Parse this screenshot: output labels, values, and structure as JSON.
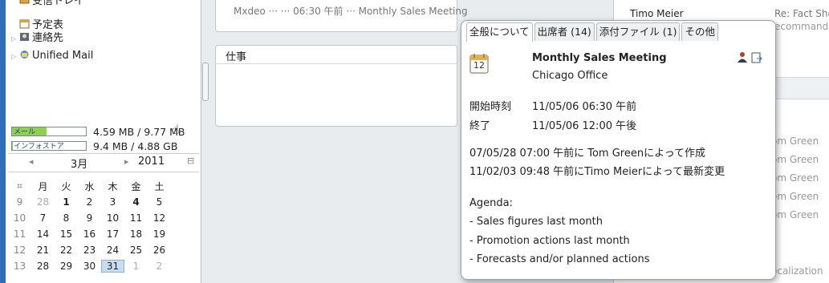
{
  "sidebar": {
    "top_item": "受信トレイ",
    "items": [
      {
        "label": "予定表"
      },
      {
        "label": "連絡先"
      },
      {
        "label": "Unified Mail"
      }
    ],
    "quota": [
      {
        "bar_label": "メール",
        "text": "4.59 MB / 9.77 MB",
        "fill": 0.47
      },
      {
        "bar_label": "インフォストア",
        "text": "9.4 MB / 4.88 GB",
        "fill": 0.01
      }
    ]
  },
  "calendar": {
    "prev": "◂",
    "month": "3月",
    "next": "▸",
    "year": "2011",
    "collapse": "⊟",
    "week_icon": "⌗",
    "weekdays": [
      "月",
      "火",
      "水",
      "木",
      "金",
      "土"
    ],
    "weeks": [
      {
        "wk": "9",
        "days": [
          "28",
          "1",
          "2",
          "3",
          "4",
          "5"
        ]
      },
      {
        "wk": "10",
        "days": [
          "7",
          "8",
          "9",
          "10",
          "11",
          "12"
        ]
      },
      {
        "wk": "11",
        "days": [
          "14",
          "15",
          "16",
          "17",
          "18",
          "19"
        ]
      },
      {
        "wk": "12",
        "days": [
          "21",
          "22",
          "23",
          "24",
          "25",
          "26"
        ]
      },
      {
        "wk": "13",
        "days": [
          "28",
          "29",
          "30",
          "31",
          "1",
          "2"
        ]
      }
    ]
  },
  "middle": {
    "top_text": "Mxdeo ··· ··· 06:30 午前 ··· Monthly Sales Meeting",
    "task_title": "仕事"
  },
  "right": {
    "top_sender": "Timo Meier",
    "top_subject": "Re: Fact Sheet",
    "top_subject2": "ecommando",
    "rows": [
      "om Green",
      "om Green",
      "om Green",
      "om Green",
      "om Green"
    ],
    "bottom": "ocalization"
  },
  "popup": {
    "tabs": [
      {
        "label": "全般について"
      },
      {
        "label": "出席者 (14)"
      },
      {
        "label": "添付ファイル (1)"
      },
      {
        "label": "その他"
      }
    ],
    "calendar_icon_text": "12",
    "title": "Monthly Sales Meeting",
    "location": "Chicago Office",
    "start_label": "開始時刻",
    "start_value": "11/05/06 06:30 午前",
    "end_label": "終了",
    "end_value": "11/05/06 12:00 午後",
    "created": "07/05/28 07:00 午前に Tom Greenによって作成",
    "modified": "11/02/03 09:48 午前にTimo Meierによって最新変更",
    "agenda_title": "Agenda:",
    "agenda": [
      "- Sales figures last month",
      "- Promotion actions last month",
      "- Forecasts and/or planned actions"
    ]
  },
  "colors": {
    "sidebar_accent": "#2f6fb7",
    "quota_fill": "#8fd14f"
  }
}
